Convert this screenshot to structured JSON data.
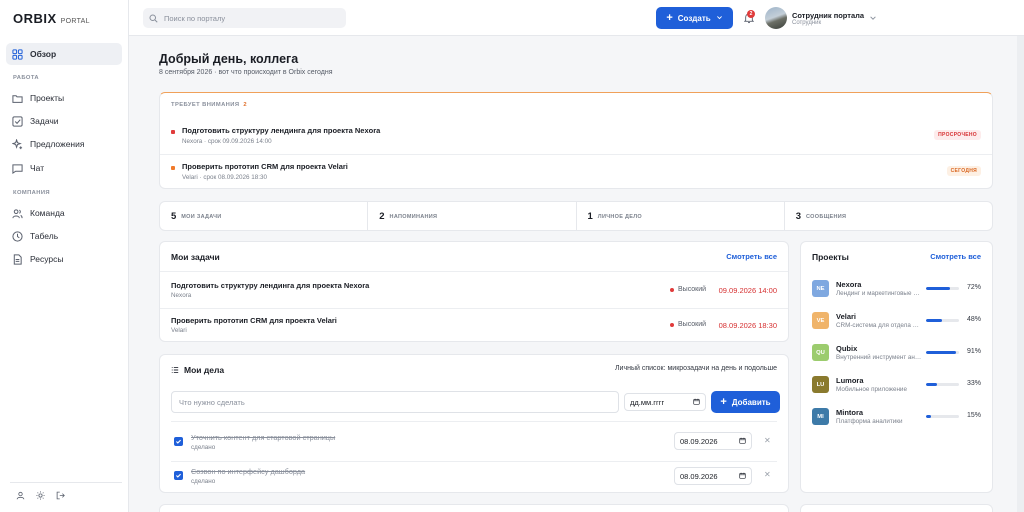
{
  "brand": {
    "name": "ORBIX",
    "suffix": "PORTAL"
  },
  "sidebar": {
    "main": [
      {
        "label": "Обзор",
        "icon": "grid-icon"
      }
    ],
    "section_work": "РАБОТА",
    "work": [
      {
        "label": "Проекты",
        "icon": "folder-icon"
      },
      {
        "label": "Задачи",
        "icon": "checkbox-icon"
      },
      {
        "label": "Предложения",
        "icon": "sparkle-icon"
      },
      {
        "label": "Чат",
        "icon": "chat-icon"
      }
    ],
    "section_company": "КОМПАНИЯ",
    "company": [
      {
        "label": "Команда",
        "icon": "users-icon"
      },
      {
        "label": "Табель",
        "icon": "clock-icon"
      },
      {
        "label": "Ресурсы",
        "icon": "document-icon"
      }
    ]
  },
  "topbar": {
    "search_placeholder": "Поиск по порталу",
    "create_label": "Создать",
    "notifications": "2",
    "user_name": "Сотрудник портала",
    "user_role": "Сотрудник"
  },
  "greeting": {
    "title": "Добрый день, коллега",
    "subtitle": "8 сентября 2026 · вот что происходит в Orbix сегодня"
  },
  "attention": {
    "title": "ТРЕБУЕТ ВНИМАНИЯ",
    "count": "2",
    "items": [
      {
        "title": "Подготовить структуру лендинга для проекта Nexora",
        "sub": "Nexora · срок 09.09.2026 14:00",
        "badge": "ПРОСРОЧЕНО",
        "color": "#e03b3b"
      },
      {
        "title": "Проверить прототип CRM для проекта Velari",
        "sub": "Velari · срок 08.09.2026 18:30",
        "badge": "СЕГОДНЯ",
        "color": "#f07a2b"
      }
    ]
  },
  "stats": [
    {
      "num": "5",
      "label": "МОИ ЗАДАЧИ"
    },
    {
      "num": "2",
      "label": "НАПОМИНАНИЯ"
    },
    {
      "num": "1",
      "label": "ЛИЧНОЕ ДЕЛО"
    },
    {
      "num": "3",
      "label": "СООБЩЕНИЯ"
    }
  ],
  "my_tasks": {
    "title": "Мои задачи",
    "see_all": "Смотреть все",
    "items": [
      {
        "title": "Подготовить структуру лендинга для проекта Nexora",
        "project": "Nexora",
        "priority": "Высокий",
        "due": "09.09.2026 14:00"
      },
      {
        "title": "Проверить прототип CRM для проекта Velari",
        "project": "Velari",
        "priority": "Высокий",
        "due": "08.09.2026 18:30"
      }
    ]
  },
  "my_deals": {
    "title": "Мои дела",
    "hint": "Личный список: микрозадачи на день и подольше",
    "input_placeholder": "Что нужно сделать",
    "date_placeholder": "дд.мм.гггг",
    "add_label": "Добавить",
    "items": [
      {
        "title": "Уточнить контент для стартовой страницы",
        "status": "сделано",
        "date": "08.09.2026"
      },
      {
        "title": "Созвон по интерфейсу дашборда",
        "status": "сделано",
        "date": "08.09.2026"
      }
    ]
  },
  "projects": {
    "title": "Проекты",
    "see_all": "Смотреть все",
    "items": [
      {
        "abbr": "NE",
        "name": "Nexora",
        "desc": "Лендинг и маркетинговые материалы",
        "progress": 72,
        "pct": "72%",
        "color": "#7fa8e0"
      },
      {
        "abbr": "VE",
        "name": "Velari",
        "desc": "CRM-система для отдела продаж",
        "progress": 48,
        "pct": "48%",
        "color": "#f0b46a"
      },
      {
        "abbr": "QU",
        "name": "Qubix",
        "desc": "Внутренний инструмент аналитики",
        "progress": 91,
        "pct": "91%",
        "color": "#9ccc6e"
      },
      {
        "abbr": "LU",
        "name": "Lumora",
        "desc": "Мобильное приложение",
        "progress": 33,
        "pct": "33%",
        "color": "#8a7a2e"
      },
      {
        "abbr": "MI",
        "name": "Mintora",
        "desc": "Платформа аналитики",
        "progress": 15,
        "pct": "15%",
        "color": "#3d7aa8"
      }
    ]
  }
}
